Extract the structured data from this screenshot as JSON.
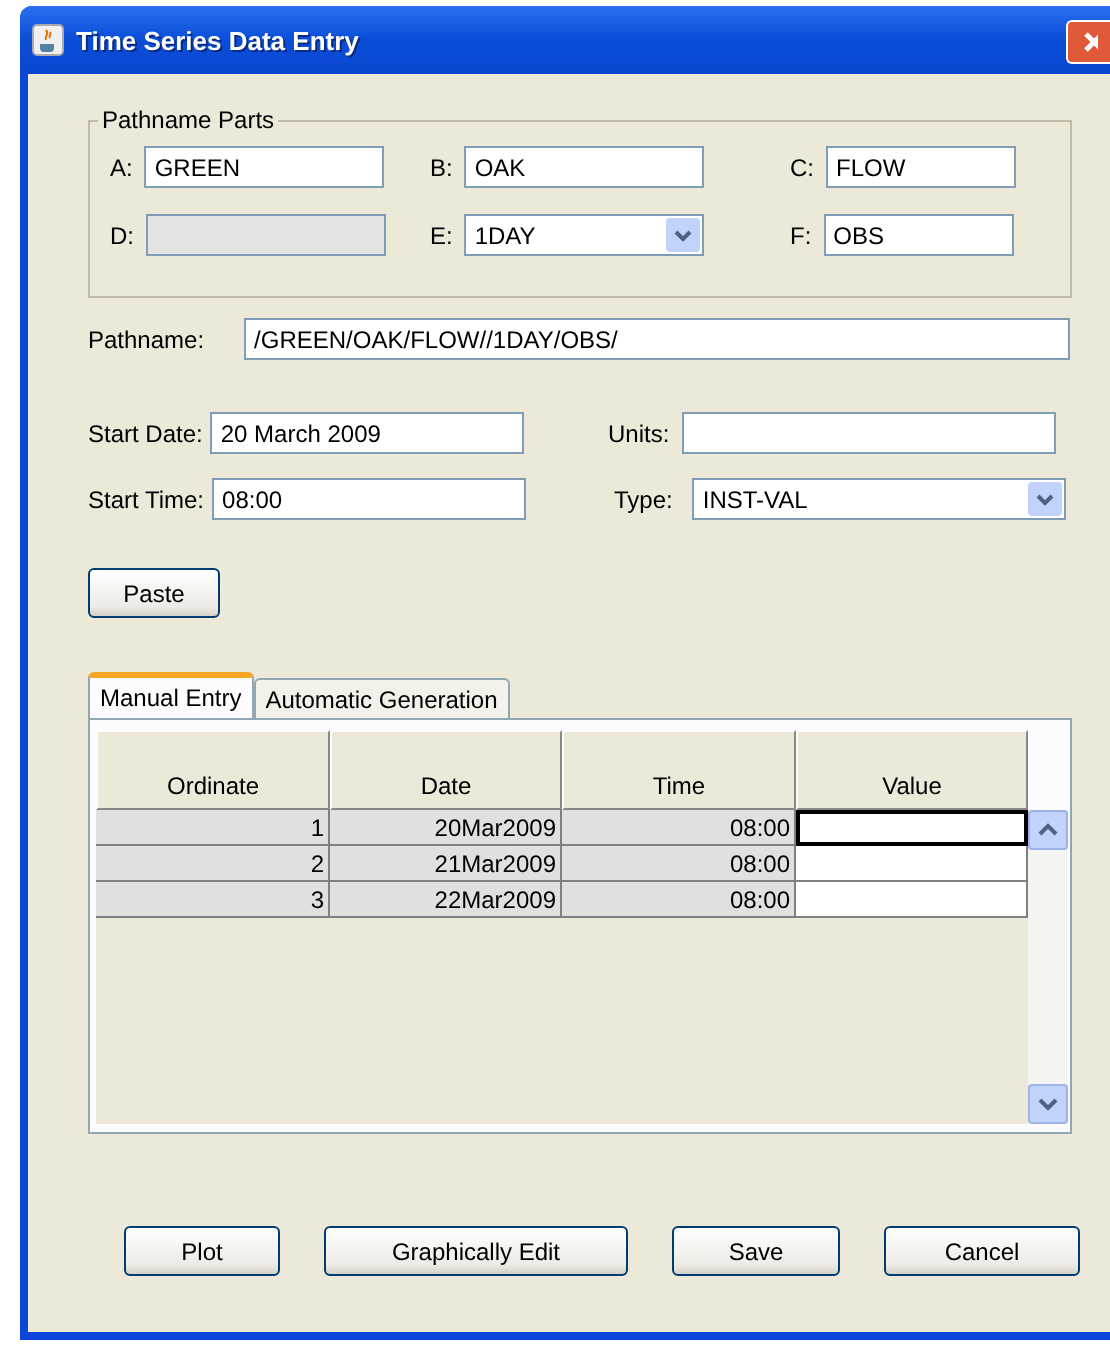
{
  "window": {
    "title": "Time Series Data Entry"
  },
  "pathname_parts": {
    "title": "Pathname Parts",
    "fields": [
      {
        "label": "A:",
        "value": "GREEN",
        "kind": "text",
        "disabled": false
      },
      {
        "label": "B:",
        "value": "OAK",
        "kind": "text",
        "disabled": false
      },
      {
        "label": "C:",
        "value": "FLOW",
        "kind": "text",
        "disabled": false
      },
      {
        "label": "D:",
        "kind": "text",
        "disabled": true
      },
      {
        "label": "E:",
        "value": "1DAY",
        "kind": "combo",
        "disabled": false
      },
      {
        "label": "F:",
        "value": "OBS",
        "kind": "text",
        "disabled": false
      }
    ]
  },
  "pathname": {
    "label": "Pathname:",
    "value": "/GREEN/OAK/FLOW//1DAY/OBS/"
  },
  "start_date": {
    "label": "Start Date:",
    "value": "20 March 2009"
  },
  "units": {
    "label": "Units:"
  },
  "start_time": {
    "label": "Start Time:",
    "value": "08:00"
  },
  "type": {
    "label": "Type:",
    "value": "INST-VAL"
  },
  "paste_button": "Paste",
  "tabs": [
    {
      "label": "Manual Entry",
      "selected": true
    },
    {
      "label": "Automatic Generation",
      "selected": false
    }
  ],
  "table": {
    "columns": [
      "Ordinate",
      "Date",
      "Time",
      "Value"
    ],
    "rows": [
      {
        "ordinate": "1",
        "date": "20Mar2009",
        "time": "08:00",
        "focused": true
      },
      {
        "ordinate": "2",
        "date": "21Mar2009",
        "time": "08:00",
        "focused": false
      },
      {
        "ordinate": "3",
        "date": "22Mar2009",
        "time": "08:00",
        "focused": false
      }
    ]
  },
  "buttons": [
    "Plot",
    "Graphically Edit",
    "Save",
    "Cancel"
  ]
}
